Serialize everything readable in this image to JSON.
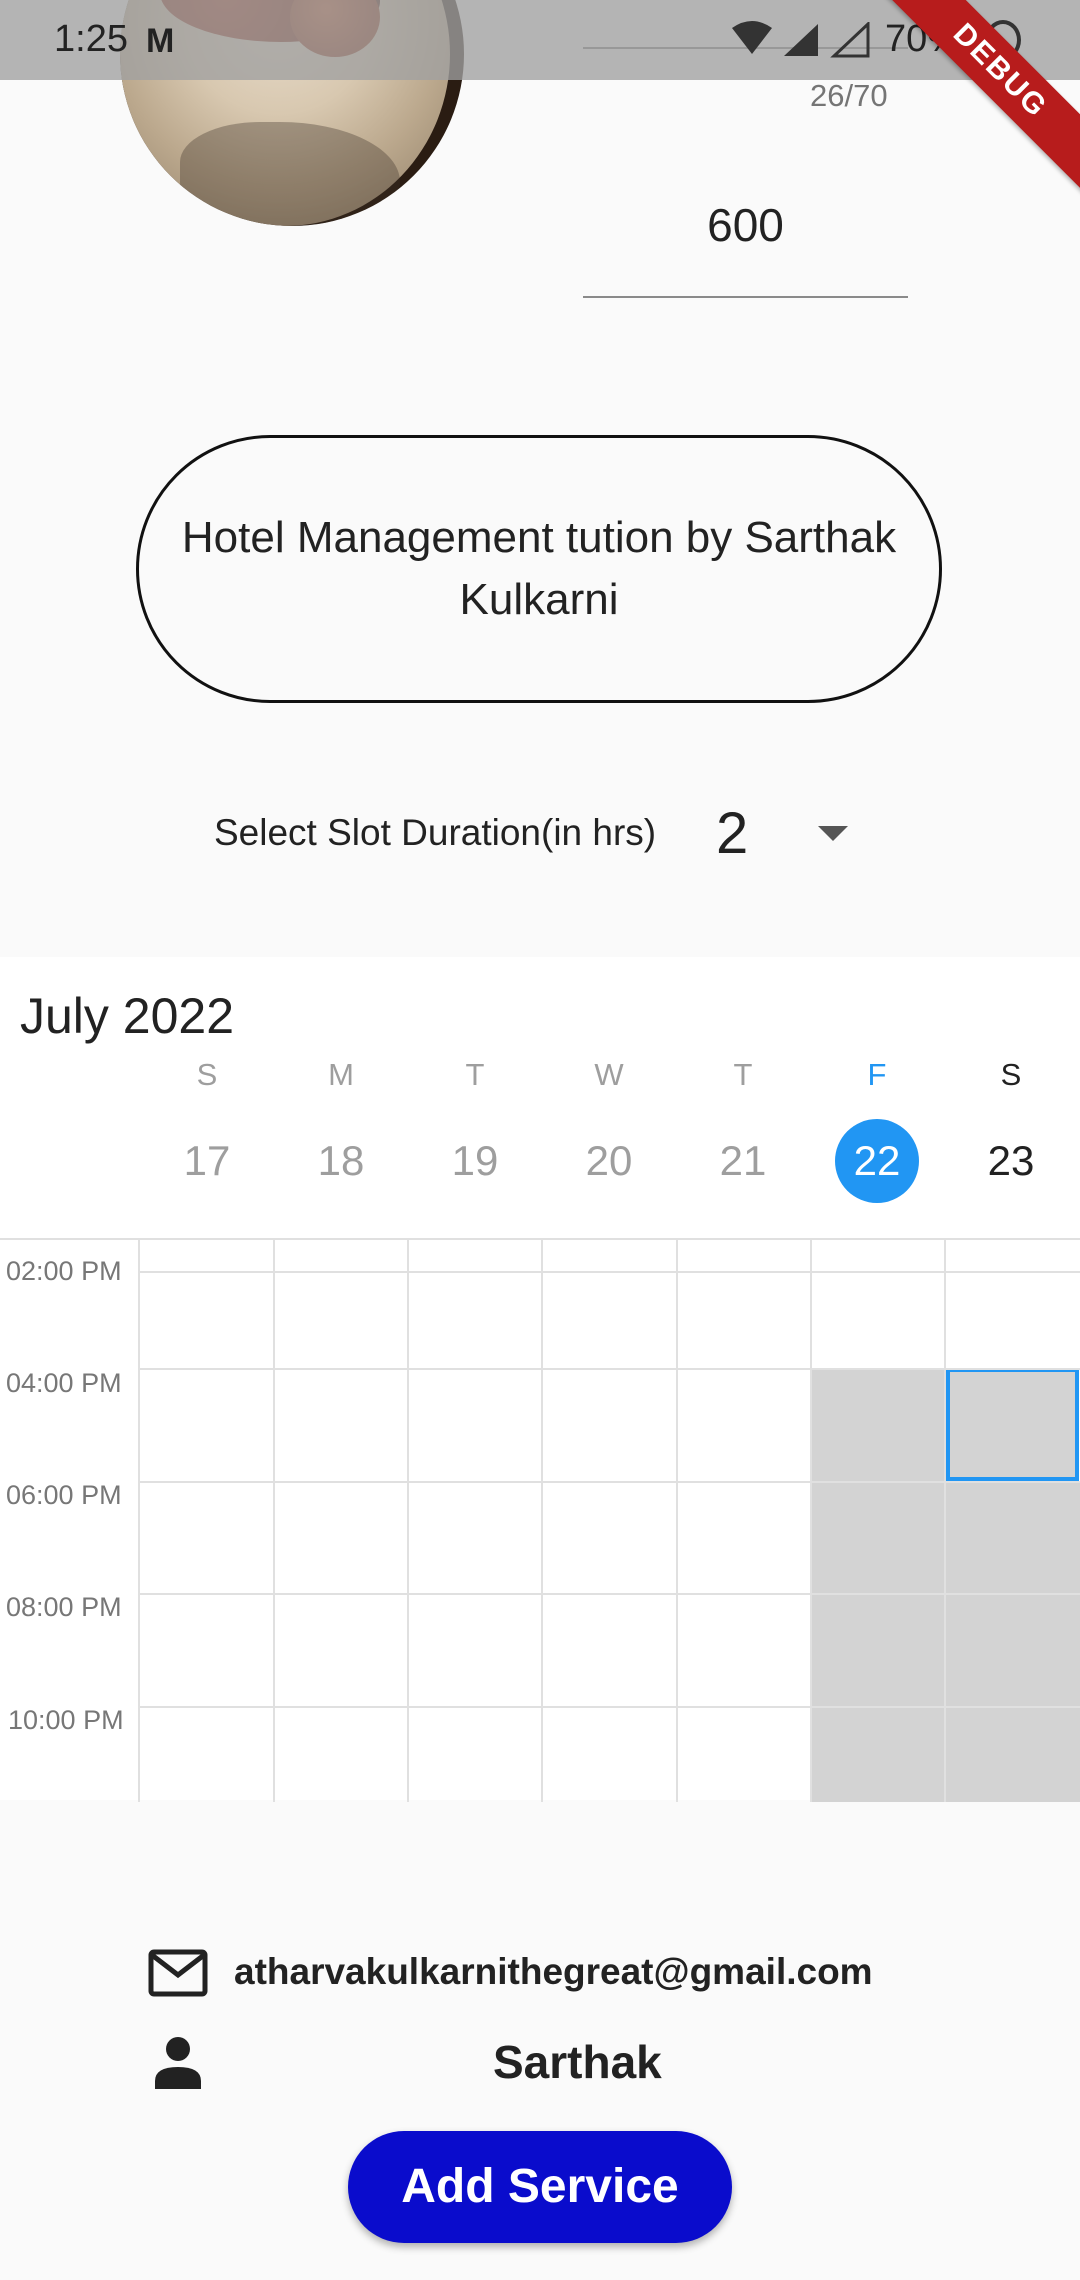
{
  "status_bar": {
    "time": "1:25",
    "notification_icon": "gmail-icon",
    "battery_text": "70%"
  },
  "debug_banner": "DEBUG",
  "form": {
    "char_counter": "26/70",
    "price_value": "600"
  },
  "service_title": "Hotel Management tution by Sarthak Kulkarni",
  "slot": {
    "label": "Select Slot Duration(in hrs)",
    "value": "2"
  },
  "calendar": {
    "month": "July 2022",
    "days": [
      {
        "dow": "S",
        "date": "17"
      },
      {
        "dow": "M",
        "date": "18"
      },
      {
        "dow": "T",
        "date": "19"
      },
      {
        "dow": "W",
        "date": "20"
      },
      {
        "dow": "T",
        "date": "21"
      },
      {
        "dow": "F",
        "date": "22"
      },
      {
        "dow": "S",
        "date": "23"
      }
    ],
    "today": "22",
    "times": [
      "02:00 PM",
      "04:00 PM",
      "06:00 PM",
      "08:00 PM",
      "10:00 PM"
    ],
    "accent_color": "#2196f3"
  },
  "contact": {
    "email": "atharvakulkarnithegreat@gmail.com",
    "name": "Sarthak"
  },
  "add_button": {
    "label": "Add Service",
    "color": "#0a0ccc"
  }
}
